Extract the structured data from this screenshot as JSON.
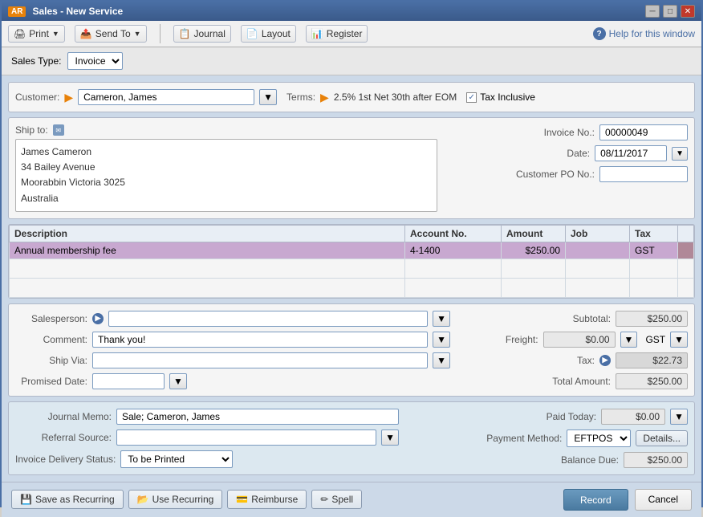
{
  "window": {
    "title": "Sales - New Service",
    "ar_label": "AR"
  },
  "toolbar": {
    "print_label": "Print",
    "send_to_label": "Send To",
    "journal_label": "Journal",
    "layout_label": "Layout",
    "register_label": "Register",
    "help_label": "Help for this window"
  },
  "sales_type": {
    "label": "Sales Type:",
    "value": "Invoice"
  },
  "customer": {
    "label": "Customer:",
    "value": "Cameron, James",
    "terms_label": "Terms:",
    "terms_value": "2.5% 1st Net 30th after EOM",
    "tax_inclusive_label": "Tax Inclusive",
    "tax_inclusive_checked": true
  },
  "ship_to": {
    "label": "Ship to:",
    "address": {
      "line1": "James Cameron",
      "line2": "34 Bailey Avenue",
      "line3": "Moorabbin Victoria  3025",
      "line4": "Australia"
    }
  },
  "invoice": {
    "number_label": "Invoice No.:",
    "number_value": "00000049",
    "date_label": "Date:",
    "date_value": "08/11/2017",
    "po_label": "Customer PO No.:",
    "po_value": ""
  },
  "line_items": {
    "columns": [
      "Description",
      "Account No.",
      "Amount",
      "Job",
      "Tax"
    ],
    "rows": [
      {
        "description": "Annual membership fee",
        "account_no": "4-1400",
        "amount": "$250.00",
        "job": "",
        "tax": "GST",
        "selected": true
      }
    ]
  },
  "bottom": {
    "salesperson_label": "Salesperson:",
    "comment_label": "Comment:",
    "comment_value": "Thank you!",
    "ship_via_label": "Ship Via:",
    "promised_date_label": "Promised Date:",
    "subtotal_label": "Subtotal:",
    "subtotal_value": "$250.00",
    "freight_label": "Freight:",
    "freight_value": "$0.00",
    "tax_label": "Tax:",
    "tax_value": "$22.73",
    "total_label": "Total Amount:",
    "total_value": "$250.00",
    "freight_tax": "GST"
  },
  "journal": {
    "memo_label": "Journal Memo:",
    "memo_value": "Sale; Cameron, James",
    "referral_label": "Referral Source:",
    "referral_value": "",
    "delivery_label": "Invoice Delivery Status:",
    "delivery_value": "To be Printed",
    "paid_today_label": "Paid Today:",
    "paid_today_value": "$0.00",
    "payment_method_label": "Payment Method:",
    "payment_method_value": "EFTPOS",
    "balance_due_label": "Balance Due:",
    "balance_due_value": "$250.00",
    "details_btn": "Details..."
  },
  "footer": {
    "save_recurring_label": "Save as Recurring",
    "use_recurring_label": "Use Recurring",
    "reimburse_label": "Reimburse",
    "spell_label": "Spell",
    "record_label": "Record",
    "cancel_label": "Cancel"
  }
}
